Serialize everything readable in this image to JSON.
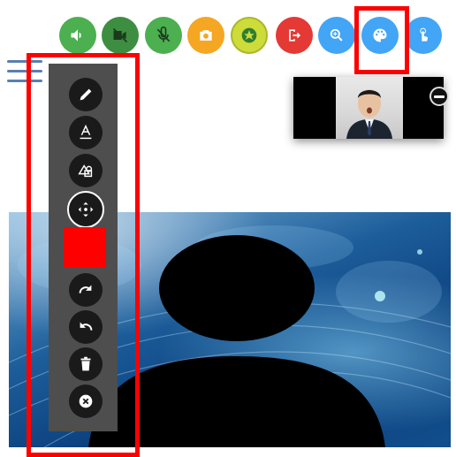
{
  "toolbar": {
    "buttons": [
      {
        "name": "speaker-button",
        "icon": "speaker-icon",
        "color": "#4caf50"
      },
      {
        "name": "camera-off-button",
        "icon": "video-off-icon",
        "color": "#3e8e41"
      },
      {
        "name": "mic-off-button",
        "icon": "mic-off-icon",
        "color": "#4caf50"
      },
      {
        "name": "snapshot-button",
        "icon": "camera-icon",
        "color": "#f5a623"
      },
      {
        "name": "favorite-button",
        "icon": "star-icon",
        "color": "#cddc39"
      },
      {
        "name": "exit-button",
        "icon": "exit-icon",
        "color": "#e53935"
      },
      {
        "name": "zoom-button",
        "icon": "zoom-icon",
        "color": "#42a5f5"
      },
      {
        "name": "palette-button",
        "icon": "palette-icon",
        "color": "#42a5f5"
      },
      {
        "name": "touch-button",
        "icon": "touch-icon",
        "color": "#42a5f5"
      }
    ]
  },
  "drawing_tools": [
    {
      "name": "pencil-tool",
      "icon": "pencil-icon"
    },
    {
      "name": "text-tool",
      "icon": "text-icon"
    },
    {
      "name": "shapes-tool",
      "icon": "shapes-icon"
    },
    {
      "name": "move-tool",
      "icon": "move-icon"
    },
    {
      "name": "redo-tool",
      "icon": "redo-icon"
    },
    {
      "name": "undo-tool",
      "icon": "undo-icon"
    },
    {
      "name": "delete-tool",
      "icon": "trash-icon"
    },
    {
      "name": "close-tool",
      "icon": "close-icon"
    }
  ],
  "colors": {
    "selected_draw_color": "#ff0000",
    "highlight": "#ff0000",
    "panel": "#4e4e4e"
  }
}
